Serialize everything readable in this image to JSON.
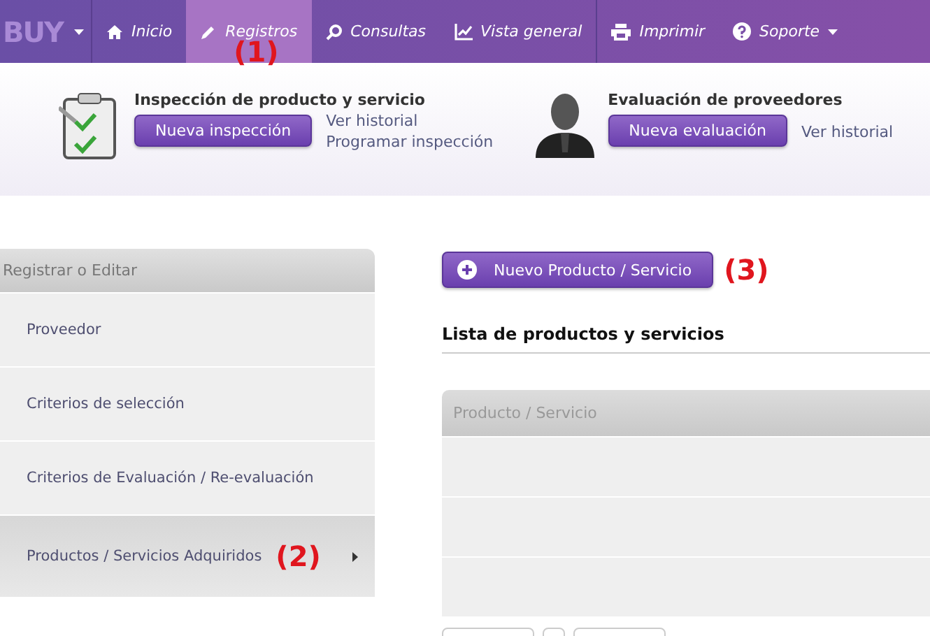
{
  "navbar": {
    "brand": "BUY",
    "items": [
      {
        "label": "Inicio",
        "selected": false
      },
      {
        "label": "Registros",
        "selected": true,
        "callout": "(1)"
      },
      {
        "label": "Consultas",
        "selected": false
      },
      {
        "label": "Vista general",
        "selected": false
      },
      {
        "label": "Imprimir",
        "selected": false,
        "divider": true
      },
      {
        "label": "Soporte",
        "selected": false,
        "dropdown": true
      }
    ]
  },
  "quick_actions": [
    {
      "title": "Inspección de producto y servicio",
      "button": "Nueva inspección",
      "links": [
        "Ver historial",
        "Programar inspección"
      ]
    },
    {
      "title": "Evaluación de proveedores",
      "button": "Nueva evaluación",
      "links": [
        "Ver historial"
      ]
    }
  ],
  "sidebar": {
    "title": "Registrar o Editar",
    "items": [
      {
        "label": "Proveedor",
        "selected": false
      },
      {
        "label": "Criterios de selección",
        "selected": false
      },
      {
        "label": "Criterios de Evaluación / Re-evaluación",
        "selected": false
      },
      {
        "label": "Productos / Servicios Adquiridos",
        "selected": true,
        "callout": "(2)"
      }
    ]
  },
  "main": {
    "new_button": "Nuevo Producto / Servicio",
    "callout": "(3)",
    "list_title": "Lista de productos y servicios",
    "table": {
      "columns": [
        "Producto / Servicio"
      ]
    }
  }
}
